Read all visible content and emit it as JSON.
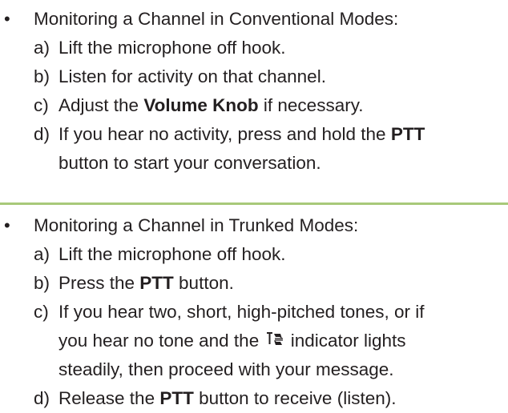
{
  "section1": {
    "heading": "Monitoring a Channel in Conventional Modes:",
    "items": {
      "a": {
        "label": "a)",
        "text": "Lift the microphone off hook."
      },
      "b": {
        "label": "b)",
        "text": "Listen for activity on that channel."
      },
      "c": {
        "label": "c)",
        "pre": "Adjust the ",
        "bold": "Volume Knob",
        "post": " if necessary."
      },
      "d": {
        "label": "d)",
        "pre": "If you hear no activity, press and hold the ",
        "bold": "PTT",
        "line2": "button to start your conversation."
      }
    }
  },
  "section2": {
    "heading": "Monitoring a Channel in Trunked Modes:",
    "items": {
      "a": {
        "label": "a)",
        "text": "Lift the microphone off hook."
      },
      "b": {
        "label": "b)",
        "pre": "Press the ",
        "bold": "PTT",
        "post": " button."
      },
      "c": {
        "label": "c)",
        "line1": "If you hear two, short, high-pitched tones, or if",
        "line2_pre": "you hear no tone and the",
        "line2_post": "indicator lights",
        "line3": "steadily, then proceed with your message.",
        "icon": "trunking-indicator-icon"
      },
      "d": {
        "label": "d)",
        "pre": "Release the ",
        "bold": "PTT",
        "post": " button to receive (listen)."
      }
    }
  },
  "bullet_glyph": "•",
  "colors": {
    "text": "#231f20",
    "divider": "#a8c979"
  }
}
